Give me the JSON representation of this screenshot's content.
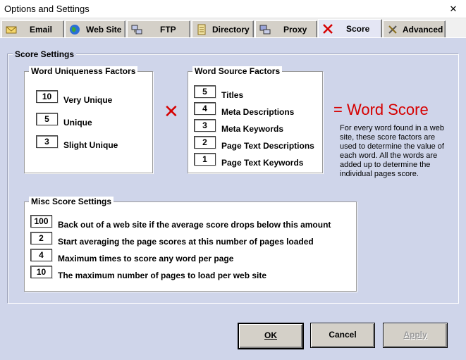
{
  "window": {
    "title": "Options and Settings",
    "close_glyph": "✕"
  },
  "tabs": [
    {
      "label": "Email",
      "icon": "envelope-icon"
    },
    {
      "label": "Web Site",
      "icon": "globe-icon"
    },
    {
      "label": "FTP",
      "icon": "ftp-icon"
    },
    {
      "label": "Directory",
      "icon": "directory-icon"
    },
    {
      "label": "Proxy",
      "icon": "proxy-icon"
    },
    {
      "label": "Score",
      "icon": "red-x-icon",
      "active": true
    },
    {
      "label": "Advanced",
      "icon": "tools-icon"
    }
  ],
  "score_settings": {
    "legend": "Score Settings",
    "uniqueness": {
      "legend": "Word Uniqueness Factors",
      "items": [
        {
          "value": "10",
          "label": "Very Unique"
        },
        {
          "value": "5",
          "label": "Unique"
        },
        {
          "value": "3",
          "label": "Slight Unique"
        }
      ]
    },
    "times_symbol": "✕",
    "source": {
      "legend": "Word Source Factors",
      "items": [
        {
          "value": "5",
          "label": "Titles"
        },
        {
          "value": "4",
          "label": "Meta Descriptions"
        },
        {
          "value": "3",
          "label": "Meta Keywords"
        },
        {
          "value": "2",
          "label": "Page Text Descriptions"
        },
        {
          "value": "1",
          "label": "Page Text Keywords"
        }
      ]
    },
    "word_score": {
      "title": "= Word Score",
      "description": "For every word found in a web site, these score factors are used to determine the value of each word. All the words are added up to determine the individual pages score."
    },
    "misc": {
      "legend": "Misc Score Settings",
      "items": [
        {
          "value": "100",
          "label": "Back out of a web site if the average score drops below this amount"
        },
        {
          "value": "2",
          "label": "Start averaging the page scores at this number of pages loaded"
        },
        {
          "value": "4",
          "label": "Maximum times to score any word per page"
        },
        {
          "value": "10",
          "label": "The maximum number of pages to load per web site"
        }
      ]
    }
  },
  "buttons": {
    "ok": "OK",
    "cancel": "Cancel",
    "apply": "Apply"
  },
  "colors": {
    "accent_red": "#d60000",
    "panel_bg": "#cfd5ea"
  }
}
